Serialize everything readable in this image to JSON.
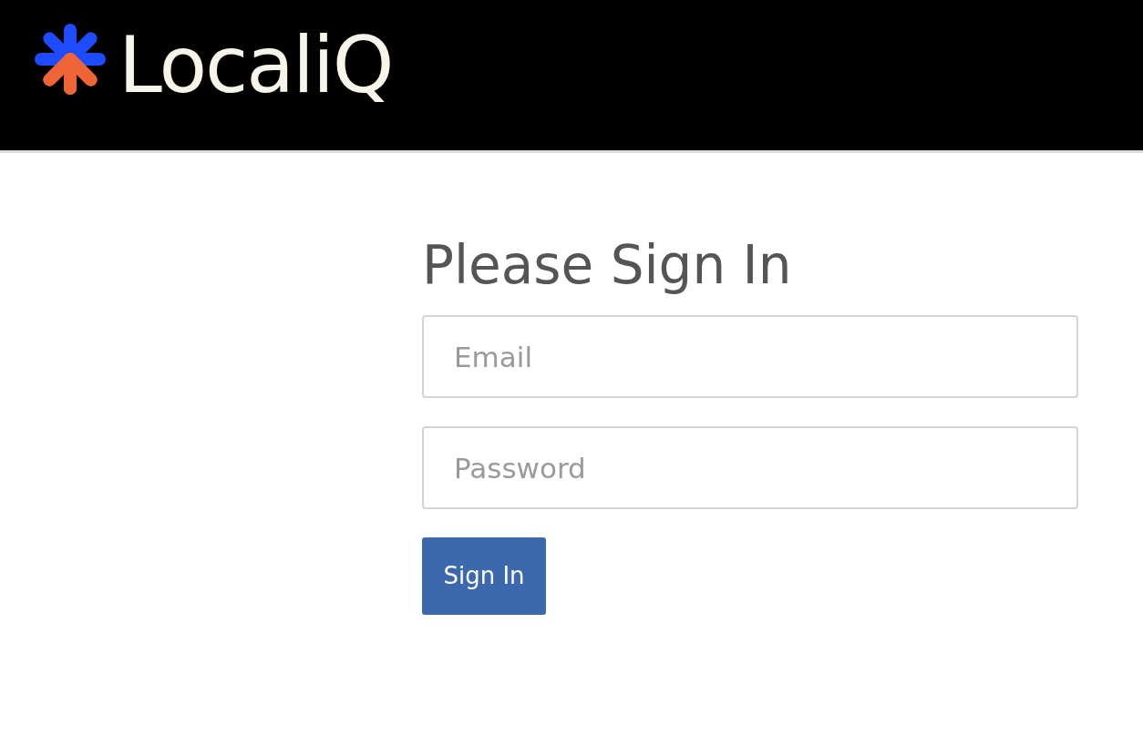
{
  "header": {
    "brand": "LocaliQ"
  },
  "form": {
    "title": "Please Sign In",
    "fields": [
      {
        "placeholder": "Email"
      },
      {
        "placeholder": "Password"
      }
    ],
    "button": "Sign In"
  }
}
